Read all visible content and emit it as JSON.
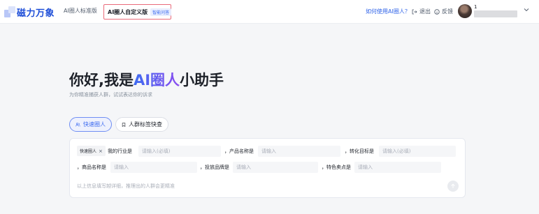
{
  "header": {
    "logo_text": "磁力万象",
    "tabs": [
      {
        "label": "AI圈人标准版"
      },
      {
        "label": "AI圈人自定义版",
        "badge": "智能问答"
      }
    ],
    "help_link": "如何使用AI圈人？",
    "logout_label": "退出",
    "feedback_label": "反馈",
    "user": {
      "name_prefix": "1"
    }
  },
  "hero": {
    "title_before": "你好,我是",
    "title_ai": "AI圈人",
    "title_after": "小助手",
    "subtitle": "为你精准捕获人群，试试表达你的诉求"
  },
  "modes": [
    {
      "label": "快速圈人"
    },
    {
      "label": "人群标签快查"
    }
  ],
  "form": {
    "chip_label": "快速圈人",
    "chip_close": "×",
    "row1": [
      {
        "label": "我的行业是",
        "placeholder": "请输入(必填)"
      },
      {
        "label": "，产品名称是",
        "placeholder": "请输入"
      },
      {
        "label": "，转化目标是",
        "placeholder": "请输入(必填)"
      }
    ],
    "row2": [
      {
        "label": "，商品名称是",
        "placeholder": "请输入"
      },
      {
        "label": "，投放品牌是",
        "placeholder": "请输入"
      },
      {
        "label": "，特色卖点是",
        "placeholder": "请输入"
      }
    ],
    "hint": "以上信息填写越详细，推理出的人群会更精准"
  },
  "colors": {
    "brand_blue": "#1f4fd8",
    "accent": "#3e6cf0",
    "highlight_border": "#e96a7a"
  }
}
